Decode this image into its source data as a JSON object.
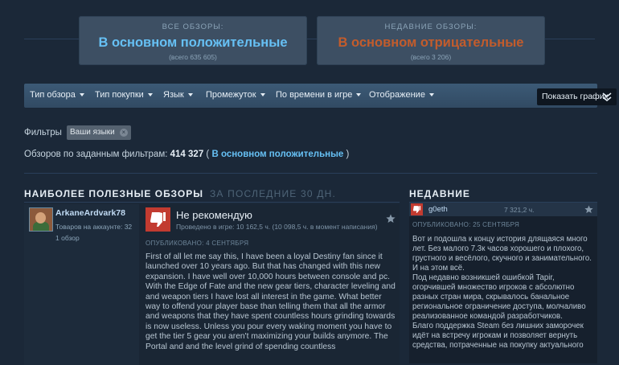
{
  "summary": {
    "all": {
      "label": "ВСЕ ОБЗОРЫ:",
      "rating": "В основном положительные",
      "count": "(всего 635 605)"
    },
    "recent": {
      "label": "НЕДАВНИЕ ОБЗОРЫ:",
      "rating": "В основном отрицательные",
      "count": "(всего 3 206)"
    }
  },
  "filters": {
    "items": [
      "Тип обзора",
      "Тип покупки",
      "Язык",
      "Промежуток",
      "По времени в игре",
      "Отображение"
    ],
    "graph_button": "Показать график",
    "filters_label": "Фильтры",
    "chip": "Ваши языки",
    "chip_close": "×",
    "stats_prefix": "Обзоров по заданным фильтрам:",
    "stats_count": "414 327",
    "stats_open": "(",
    "stats_rating": "В основном положительные",
    "stats_close": ")"
  },
  "helpful": {
    "title": "НАИБОЛЕЕ ПОЛЕЗНЫЕ ОБЗОРЫ",
    "subtitle": "ЗА ПОСЛЕДНИЕ 30 ДН.",
    "review": {
      "author": "ArkaneArdvark78",
      "products": "Товаров на аккаунте: 32",
      "reviews": "1 обзор",
      "recommendation": "Не рекомендую",
      "hours": "Проведено в игре: 10 162,5 ч. (10 098,5 ч. в момент написания)",
      "posted": "ОПУБЛИКОВАНО: 4 СЕНТЯБРЯ",
      "text": "First of all let me say this, I have been a loyal Destiny fan since it launched over 10 years ago. But that has changed with this new expansion. I have well over 10,000 hours between console and pc. With the Edge of Fate and the new gear tiers, character leveling and and weapon tiers I have lost all interest in the game. What better way to offend your player base than telling them that all the armor and weapons that they have spent countless hours grinding towards is now useless. Unless you pour every waking moment you have to get the tier 5 gear you aren't maximizing your builds anymore. The Portal and and the level grind of spending countless"
    }
  },
  "recent": {
    "title": "НЕДАВНИЕ",
    "review": {
      "author": "g0eth",
      "hours": "7 321,2 ч.",
      "posted": "ОПУБЛИКОВАНО: 25 СЕНТЯБРЯ",
      "p1": "Вот и подошла к концу история длящаяся много лет. Без малого 7.3к часов хорошего и плохого, грустного и весёлого, скучного и занимательного. И на этом всё.",
      "p2": "Под недавно возникшей ошибкой Tapir, огорчившей множество игроков с абсолютно разных стран мира, скрывалось банальное региональное ограничение доступа, молчаливо реализованное командой разработчиков.",
      "p3": "Благо поддержка Steam без лишних заморочек идёт на встречу игрокам и позволяет вернуть средства, потраченные на покупку актуального"
    }
  },
  "colors": {
    "positive": "#66c0f4",
    "negative": "#c35c2c",
    "thumb_down_bg": "#c23b30"
  },
  "icons": [
    "caret-down-icon",
    "chevron-double-down-icon",
    "thumbs-down-icon",
    "award-star-icon",
    "close-icon"
  ]
}
